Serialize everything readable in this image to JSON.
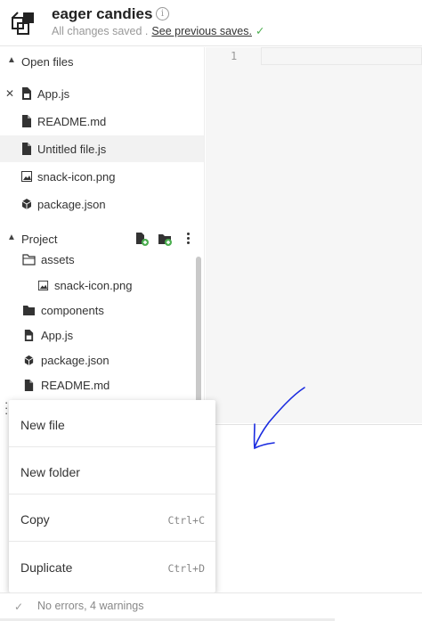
{
  "header": {
    "title": "eager candies",
    "status_text": "All changes saved .",
    "previous_saves_link": "See previous saves.",
    "info_icon": "info-icon",
    "check_icon": "check-icon"
  },
  "open_files": {
    "label": "Open files",
    "items": [
      {
        "name": "App.js",
        "icon": "js-file-icon",
        "closable": true
      },
      {
        "name": "README.md",
        "icon": "file-icon"
      },
      {
        "name": "Untitled file.js",
        "icon": "file-icon",
        "selected": true
      },
      {
        "name": "snack-icon.png",
        "icon": "image-icon"
      },
      {
        "name": "package.json",
        "icon": "package-icon"
      }
    ]
  },
  "project": {
    "label": "Project",
    "tree": [
      {
        "name": "assets",
        "icon": "folder-open-icon"
      },
      {
        "name": "snack-icon.png",
        "icon": "image-icon"
      },
      {
        "name": "components",
        "icon": "folder-icon"
      },
      {
        "name": "App.js",
        "icon": "js-file-icon"
      },
      {
        "name": "package.json",
        "icon": "package-icon"
      },
      {
        "name": "README.md",
        "icon": "file-icon"
      }
    ]
  },
  "editor": {
    "line_numbers": [
      "1"
    ]
  },
  "context_menu": {
    "items": [
      {
        "label": "New file",
        "shortcut": ""
      },
      {
        "label": "New folder",
        "shortcut": ""
      },
      {
        "label": "Copy",
        "shortcut": "Ctrl+C"
      },
      {
        "label": "Duplicate",
        "shortcut": "Ctrl+D"
      }
    ]
  },
  "footer": {
    "message": "No errors, 4 warnings"
  },
  "colors": {
    "accent_green": "#4caf50",
    "annotation_blue": "#1a2be0"
  }
}
